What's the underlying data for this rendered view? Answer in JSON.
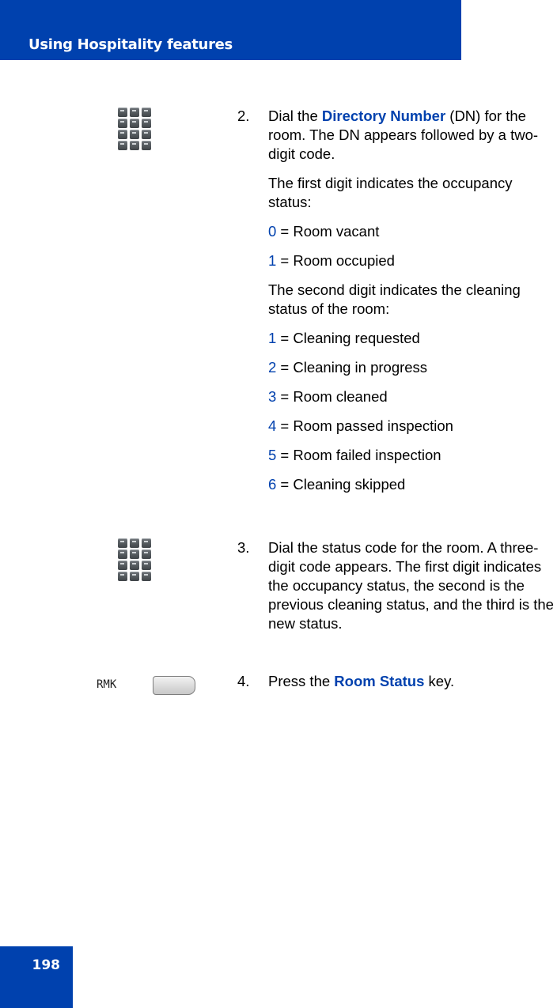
{
  "header": {
    "title": "Using Hospitality features"
  },
  "page_number": "198",
  "icons": {
    "keypad": "keypad-icon",
    "softkey": "softkey-button-icon"
  },
  "steps": [
    {
      "number": "2.",
      "intro_before": "Dial the ",
      "intro_highlight": "Directory Number",
      "intro_after": " (DN) for the room. The DN appears followed by a two-digit code.",
      "paragraph1": "The first digit indicates the occupancy status:",
      "occupancy_codes": [
        {
          "code": "0",
          "label": " = Room vacant"
        },
        {
          "code": "1",
          "label": " = Room occupied"
        }
      ],
      "paragraph2": "The second digit indicates the cleaning status of the room:",
      "cleaning_codes": [
        {
          "code": "1",
          "label": " = Cleaning requested"
        },
        {
          "code": "2",
          "label": " = Cleaning in progress"
        },
        {
          "code": "3",
          "label": " = Room cleaned"
        },
        {
          "code": "4",
          "label": " = Room passed inspection"
        },
        {
          "code": "5",
          "label": " = Room failed inspection"
        },
        {
          "code": "6",
          "label": " = Cleaning skipped"
        }
      ]
    },
    {
      "number": "3.",
      "text": "Dial the status code for the room. A three-digit code appears. The first digit indicates the occupancy status, the second is the previous cleaning status, and the third is the new status."
    },
    {
      "number": "4.",
      "text_before": "Press the ",
      "highlight": "Room Status",
      "text_after": " key.",
      "softkey_label": "RMK"
    }
  ],
  "colors": {
    "brand_blue": "#0041ae"
  }
}
